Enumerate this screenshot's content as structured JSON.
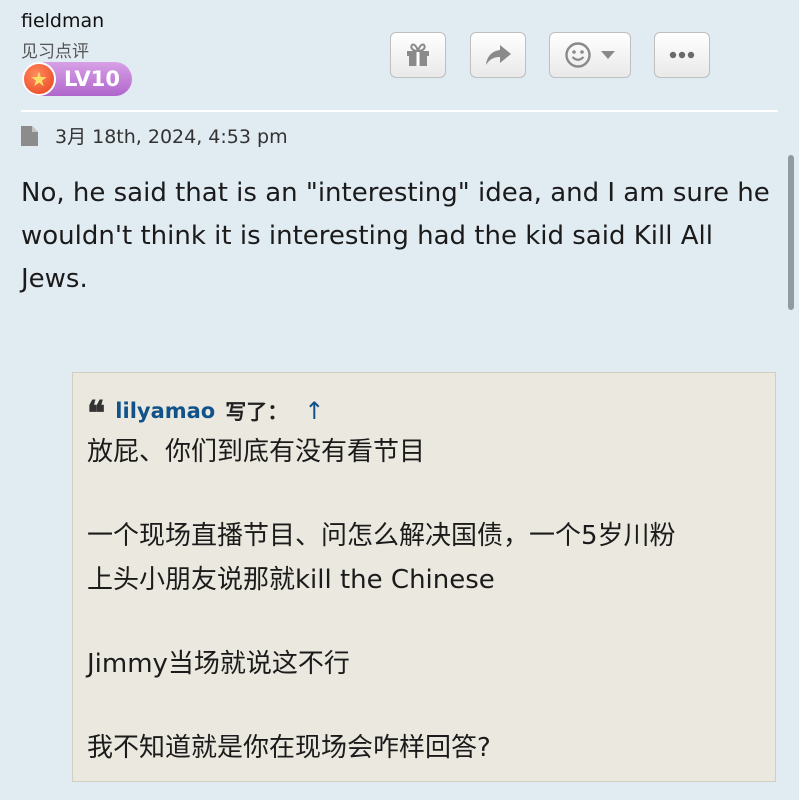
{
  "post": {
    "username": "fieldman",
    "user_rank": "见习点评",
    "level_badge": "LV10",
    "timestamp": "3月 18th, 2024, 4:53 pm",
    "body": "No, he said that is an \"interesting\" idea, and I am sure he wouldn't think it is interesting had the kid said Kill All Jews."
  },
  "toolbar": {
    "buttons": [
      {
        "icon": "gift-icon"
      },
      {
        "icon": "share-icon"
      },
      {
        "icon": "emoji-reaction-icon"
      },
      {
        "icon": "more-options-icon"
      }
    ]
  },
  "quote": {
    "author": "lilyamao",
    "wrote_label": "写了：",
    "jump_arrow": "↑",
    "lines": [
      "放屁、你们到底有没有看节目",
      "一个现场直播节目、问怎么解决国债，一个5岁川粉",
      "上头小朋友说那就kill the Chinese",
      "Jimmy当场就说这不行",
      "我不知道就是你在现场会咋样回答?"
    ]
  },
  "colors": {
    "background": "#e1ebf2",
    "quote_background": "#ebe9df",
    "link": "#105289",
    "badge": "#b066cc"
  }
}
